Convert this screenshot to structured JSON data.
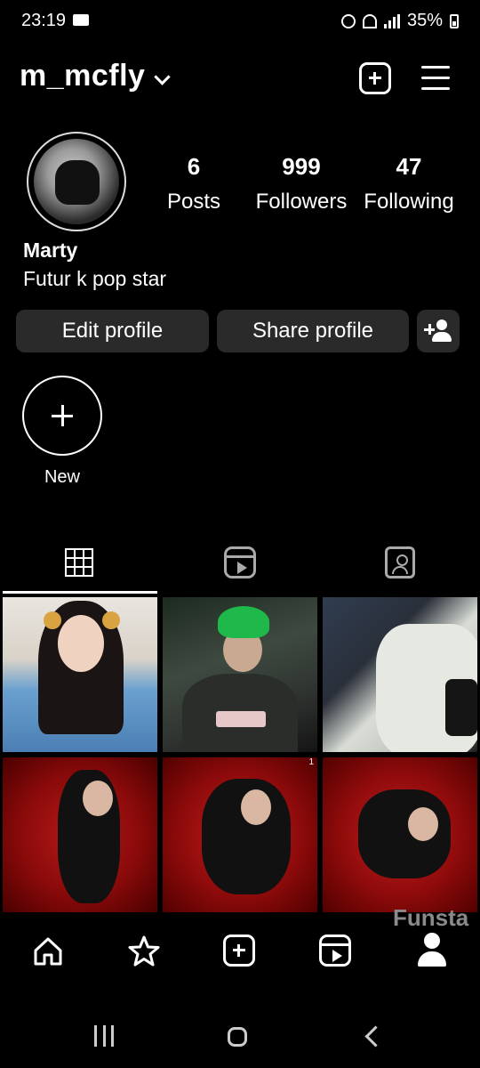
{
  "status_bar": {
    "time": "23:19",
    "battery": "35%"
  },
  "header": {
    "username": "m_mcfly"
  },
  "profile": {
    "stats": [
      {
        "value": "6",
        "label": "Posts"
      },
      {
        "value": "999",
        "label": "Followers"
      },
      {
        "value": "47",
        "label": "Following"
      }
    ],
    "name": "Marty",
    "bio": "Futur k pop star"
  },
  "actions": {
    "edit_label": "Edit profile",
    "share_label": "Share profile"
  },
  "highlights": {
    "new_label": "New"
  },
  "grid": {
    "tile_badge": "1"
  },
  "watermark": "Funsta",
  "colors": {
    "background": "#000000",
    "button": "#2a2a2a",
    "watermark": "#8a8a8a"
  }
}
